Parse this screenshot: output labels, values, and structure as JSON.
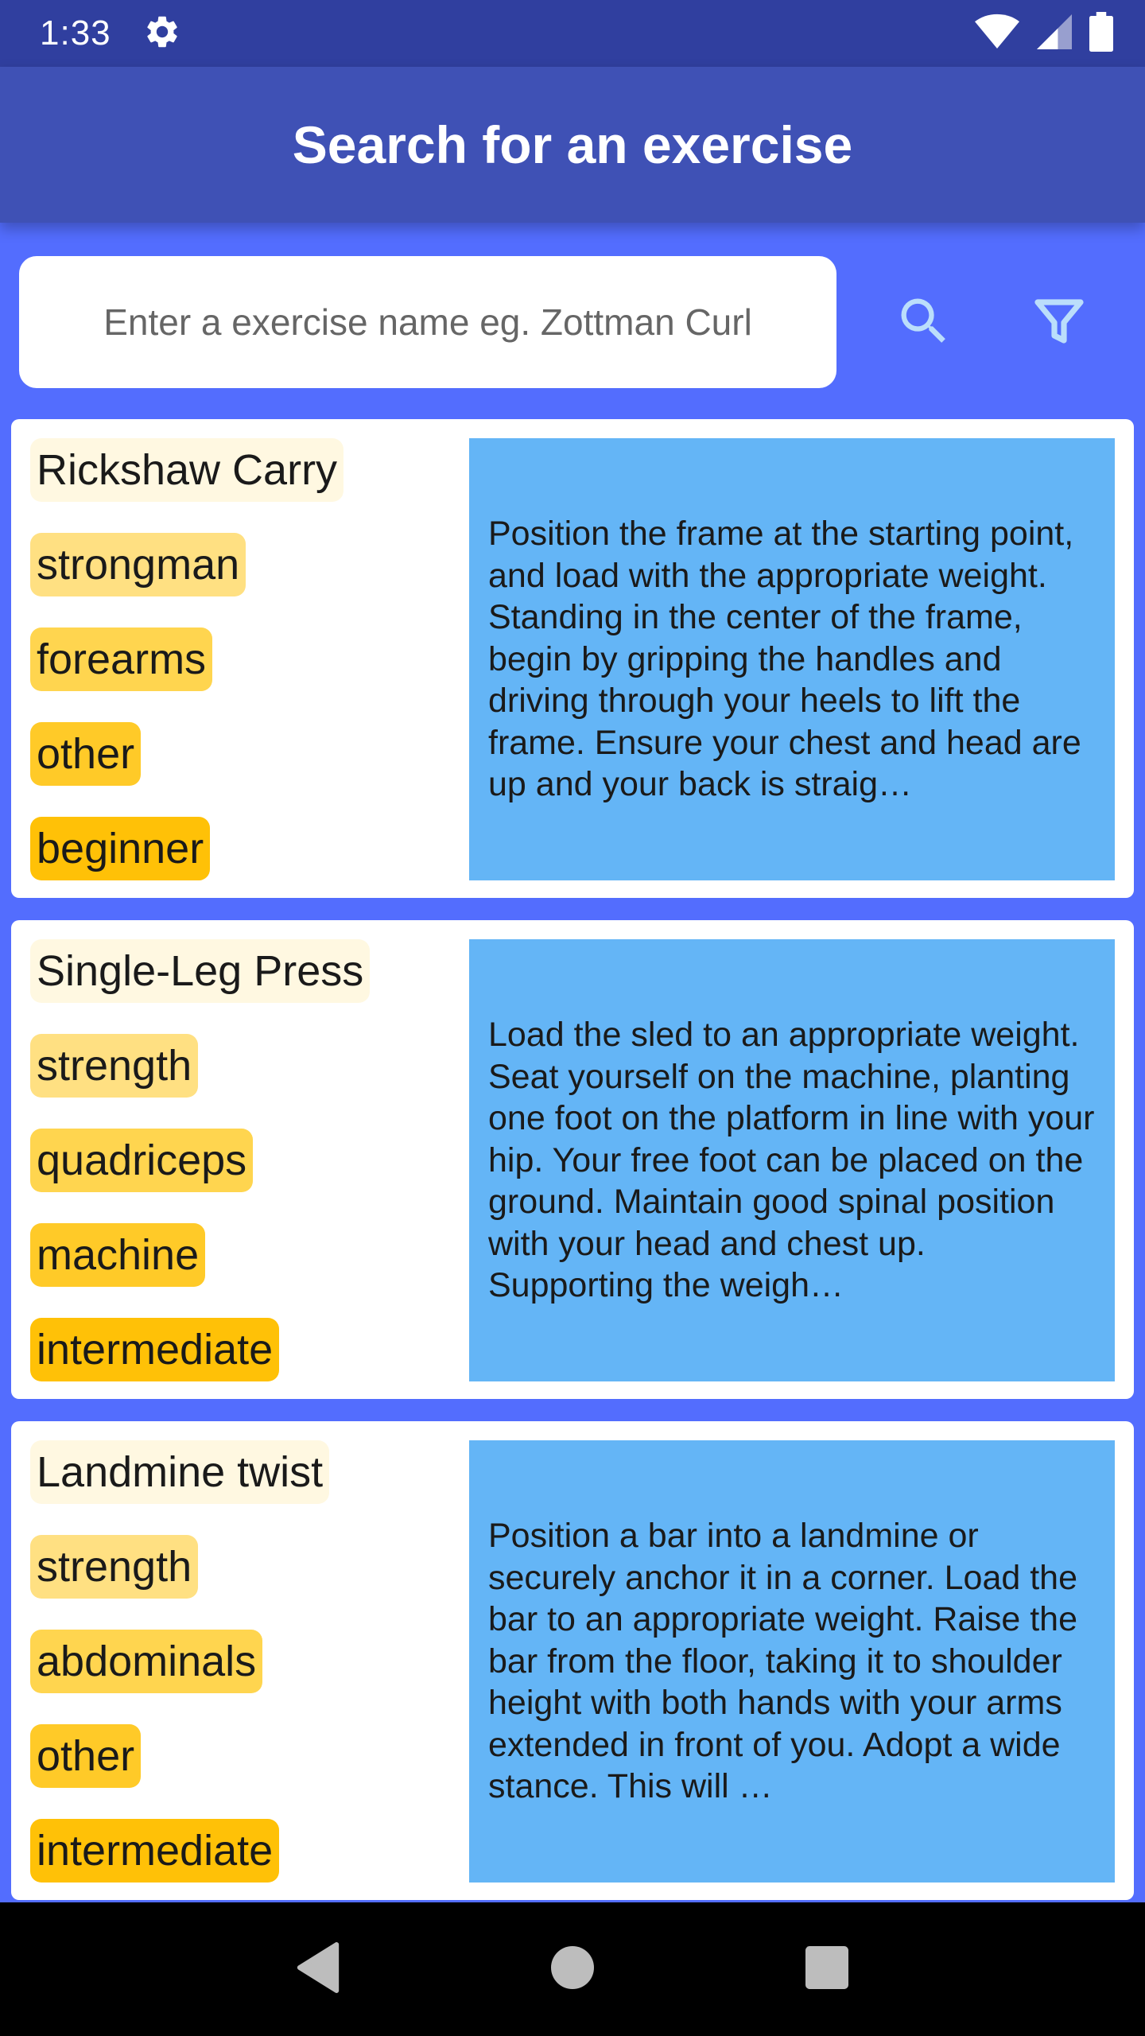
{
  "status_bar": {
    "time": "1:33",
    "icons": [
      "settings-icon",
      "wifi-icon",
      "signal-icon",
      "battery-icon"
    ]
  },
  "app_bar": {
    "title": "Search for an exercise"
  },
  "search": {
    "placeholder": "Enter a exercise name eg. Zottman Curl",
    "value": "",
    "search_icon": "search-icon",
    "filter_icon": "filter-icon"
  },
  "exercises": [
    {
      "name": "Rickshaw Carry",
      "type": "strongman",
      "muscle": "forearms",
      "equipment": "other",
      "level": "beginner",
      "description": "Position the frame at the starting point, and load with the appropriate weight. Standing in the center of the frame, begin by gripping the handles and driving through your heels to lift the frame. Ensure your chest and head are up and your back is straig…"
    },
    {
      "name": "Single-Leg Press",
      "type": "strength",
      "muscle": "quadriceps",
      "equipment": "machine",
      "level": "intermediate",
      "description": "Load the sled to an appropriate weight. Seat yourself on the machine, planting one foot on the platform in line with your hip. Your free foot can be placed on the ground. Maintain good spinal position with your head and chest up. Supporting the weigh…"
    },
    {
      "name": "Landmine twist",
      "type": "strength",
      "muscle": "abdominals",
      "equipment": "other",
      "level": "intermediate",
      "description": "Position a bar into a landmine or securely anchor it in a corner. Load the bar to an appropriate weight. Raise the bar from the floor, taking it to shoulder height with both hands with your arms extended in front of you. Adopt a wide stance. This will …"
    }
  ],
  "nav_bar": {
    "icons": [
      "back-icon",
      "home-icon",
      "recents-icon"
    ]
  },
  "colors": {
    "status_bar": "#303F9F",
    "app_bar": "#3F51B5",
    "background": "#536DFE",
    "description_box": "#64B5F6",
    "tag_name": "#FFF8E1",
    "tag_type": "#FFE082",
    "tag_muscle": "#FFD54F",
    "tag_equipment": "#FFCA28",
    "tag_level": "#FFC107"
  }
}
